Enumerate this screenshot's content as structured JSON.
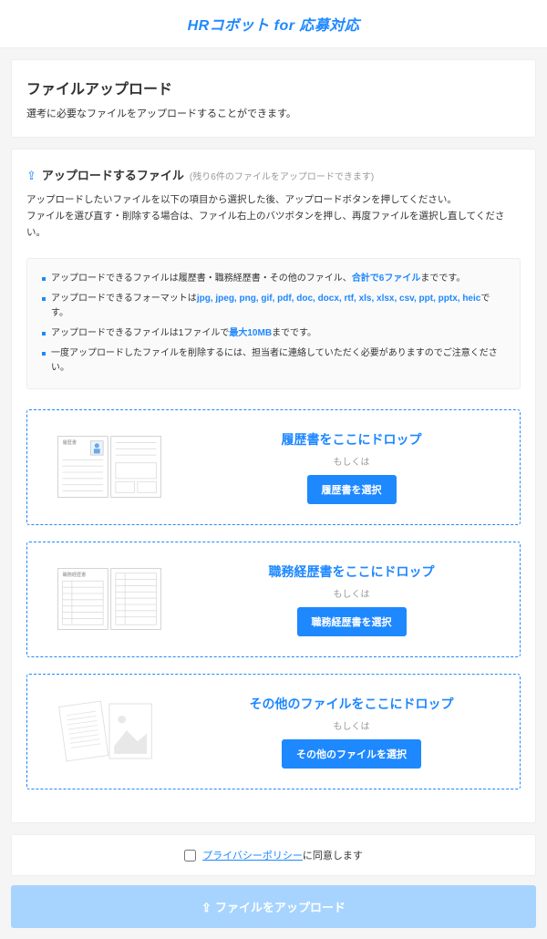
{
  "header": {
    "logo_html": "HRコボット for 応募対応"
  },
  "intro": {
    "title": "ファイルアップロード",
    "desc": "選考に必要なファイルをアップロードすることができます。"
  },
  "section": {
    "title": "アップロードするファイル",
    "sub": "(残り6件のファイルをアップロードできます)",
    "instr1": "アップロードしたいファイルを以下の項目から選択した後、アップロードボタンを押してください。",
    "instr2": "ファイルを選び直す・削除する場合は、ファイル右上のバツボタンを押し、再度ファイルを選択し直してください。"
  },
  "rules": {
    "r1a": "アップロードできるファイルは履歴書・職務経歴書・その他のファイル、",
    "r1b": "合計で6ファイル",
    "r1c": "までです。",
    "r2a": "アップロードできるフォーマットは",
    "r2b": "jpg, jpeg, png, gif, pdf, doc, docx, rtf, xls, xlsx, csv, ppt, pptx, heic",
    "r2c": "です。",
    "r3a": "アップロードできるファイルは1ファイルで",
    "r3b": "最大10MB",
    "r3c": "までです。",
    "r4": "一度アップロードしたファイルを削除するには、担当者に連絡していただく必要がありますのでご注意ください。"
  },
  "drop": {
    "resume": {
      "title": "履歴書をここにドロップ",
      "or": "もしくは",
      "btn": "履歴書を選択"
    },
    "cv": {
      "title": "職務経歴書をここにドロップ",
      "or": "もしくは",
      "btn": "職務経歴書を選択"
    },
    "other": {
      "title": "その他のファイルをここにドロップ",
      "or": "もしくは",
      "btn": "その他のファイルを選択"
    }
  },
  "consent": {
    "link": "プライバシーポリシー",
    "suffix": "に同意します"
  },
  "upload_btn": "ファイルをアップロード"
}
